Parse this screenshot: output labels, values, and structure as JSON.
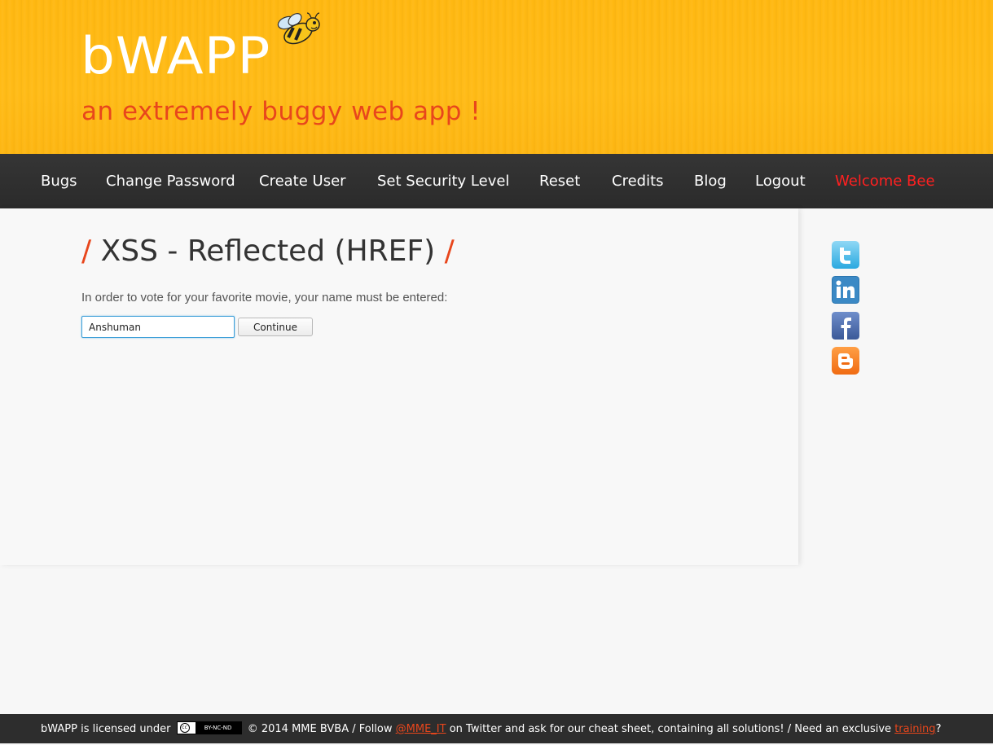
{
  "header": {
    "logo": "bWAPP",
    "tagline": "an extremely buggy web app !"
  },
  "nav": {
    "items": [
      {
        "label": "Bugs"
      },
      {
        "label": "Change Password"
      },
      {
        "label": "Create User"
      },
      {
        "label": "Set Security Level"
      },
      {
        "label": "Reset"
      },
      {
        "label": "Credits"
      },
      {
        "label": "Blog"
      },
      {
        "label": "Logout"
      },
      {
        "label": "Welcome Bee"
      }
    ]
  },
  "main": {
    "title_slash_left": "/",
    "title": "XSS - Reflected (HREF)",
    "title_slash_right": "/",
    "prompt": "In order to vote for your favorite movie, your name must be entered:",
    "name_value": "Anshuman",
    "continue_label": "Continue"
  },
  "social": {
    "icons": [
      "twitter-icon",
      "linkedin-icon",
      "facebook-icon",
      "blogger-icon"
    ]
  },
  "footer": {
    "part1": "bWAPP is licensed under",
    "cc_badge": "BY-NC-ND",
    "part2": "© 2014 MME BVBA / Follow",
    "twitter_link": "@MME_IT",
    "part3": "on Twitter and ask for our cheat sheet, containing all solutions! / Need an exclusive",
    "training_link": "training",
    "part4": "?"
  },
  "colors": {
    "header_bg": "#ffb811",
    "accent": "#e8461c",
    "nav_bg": "#2d2d2d",
    "welcome": "#ff2020"
  }
}
